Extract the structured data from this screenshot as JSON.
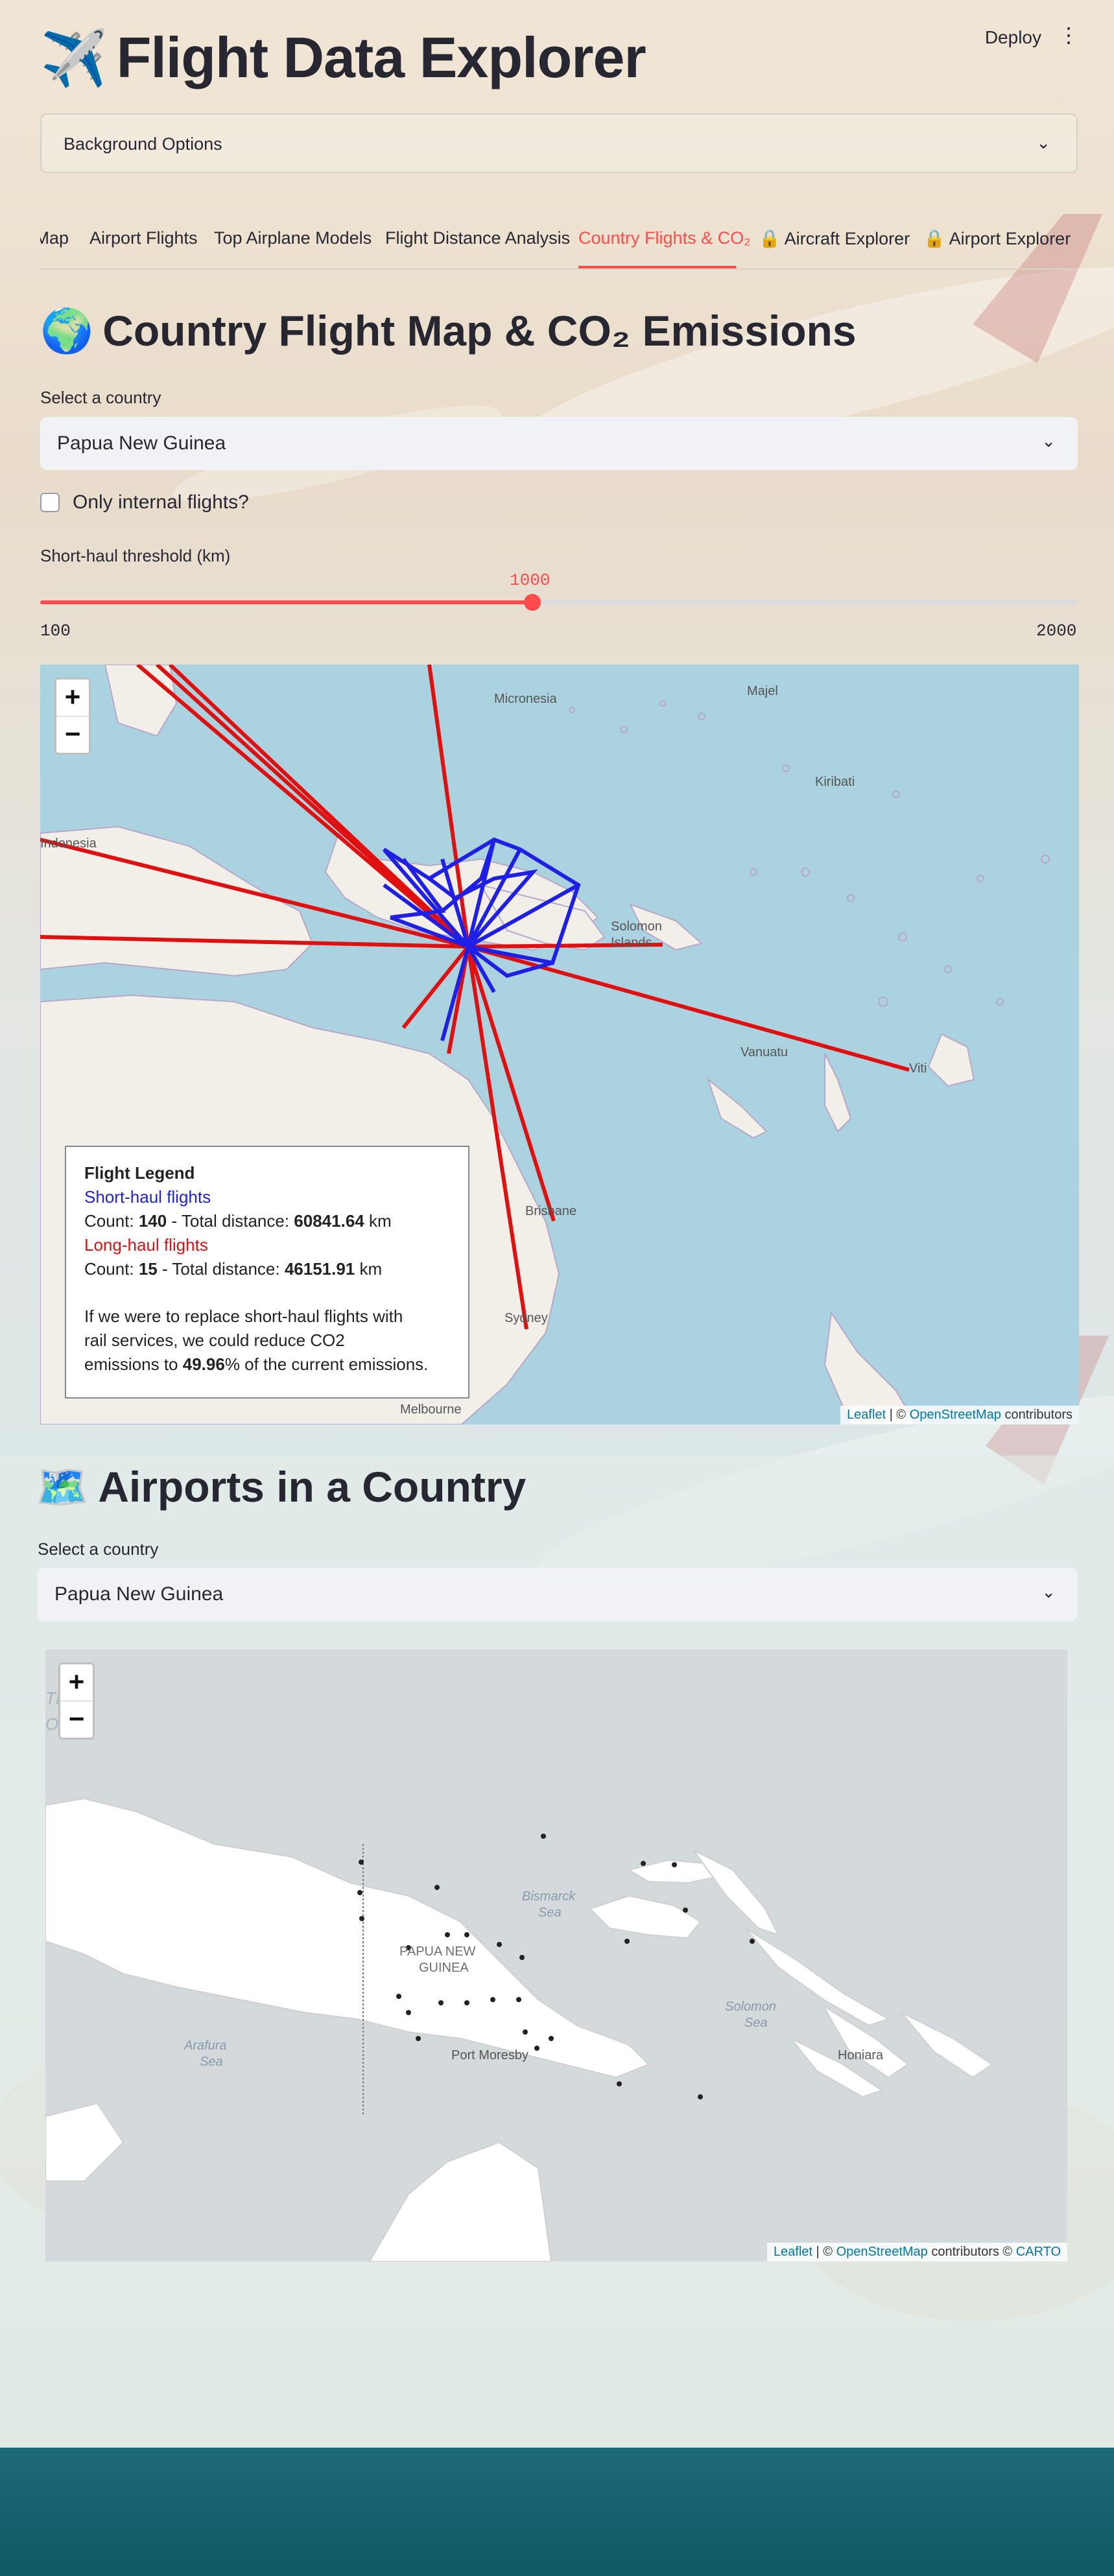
{
  "header": {
    "deploy_label": "Deploy",
    "menu_icon": "⋮"
  },
  "app": {
    "title_emoji": "✈️",
    "title": "Flight Data Explorer"
  },
  "expander": {
    "label": "Background Options",
    "chevron": "⌄"
  },
  "tabs": [
    {
      "label": "Map"
    },
    {
      "label": "Airport Flights"
    },
    {
      "label": "Top Airplane Models"
    },
    {
      "label": "Flight Distance Analysis"
    },
    {
      "label": "Country Flights & CO₂"
    },
    {
      "label": "🔒 Aircraft Explorer"
    },
    {
      "label": "🔒 Airport Explorer"
    }
  ],
  "section1": {
    "emoji": "🌍",
    "title": "Country Flight Map & CO₂ Emissions",
    "select_label": "Select a country",
    "select_value": "Papua New Guinea",
    "checkbox_label": "Only internal flights?",
    "checkbox_checked": false,
    "slider_label": "Short-haul threshold (km)",
    "slider_value": "1000",
    "slider_min": "100",
    "slider_max": "2000"
  },
  "map1": {
    "zoom_in": "+",
    "zoom_out": "−",
    "attribution_leaflet": "Leaflet",
    "attribution_sep": " | © ",
    "attribution_osm": "OpenStreetMap",
    "attribution_tail": " contributors",
    "labels": {
      "micronesia": "Micronesia",
      "majel": "Majel",
      "kiribati": "Kiribati",
      "indonesia": "Indonesia",
      "solomon": "Solomon",
      "islands": "Islands",
      "vanuatu": "Vanuatu",
      "viti": "Viti",
      "brisbane": "Brisbane",
      "sydney": "Sydney",
      "melbourne": "Melbourne"
    },
    "colors": {
      "short_haul": "#1f1fe6",
      "long_haul": "#e01010",
      "ocean": "#aad3df"
    },
    "legend": {
      "title": "Flight Legend",
      "short_label": "Short-haul flights",
      "short_count_prefix": "Count: ",
      "short_count": "140",
      "short_mid": " - Total distance: ",
      "short_distance": "60841.64",
      "short_unit": " km",
      "long_label": "Long-haul flights",
      "long_count_prefix": "Count: ",
      "long_count": "15",
      "long_mid": " - Total distance: ",
      "long_distance": "46151.91",
      "long_unit": " km",
      "note_1": "If we were to replace short-haul flights with",
      "note_2": "rail services, we could reduce CO2",
      "note_3_prefix": "emissions to ",
      "note_3_value": "49.96",
      "note_3_suffix": "% of the current emissions."
    }
  },
  "section2": {
    "emoji": "🗺️",
    "title": "Airports in a Country",
    "select_label": "Select a country",
    "select_value": "Papua New Guinea"
  },
  "map2": {
    "zoom_in": "+",
    "zoom_out": "−",
    "attribution_leaflet": "Leaflet",
    "attribution_sep": " | © ",
    "attribution_osm": "OpenStreetMap",
    "attribution_mid": " contributors © ",
    "attribution_carto": "CARTO",
    "labels": {
      "bismarck": "Bismarck",
      "sea1": "Sea",
      "png1": "PAPUA NEW",
      "png2": "GUINEA",
      "arafura": "Arafura",
      "sea2": "Sea",
      "port_moresby": "Port Moresby",
      "solomon": "Solomon",
      "sea3": "Sea",
      "honiara": "Honiara",
      "edge1": "TL",
      "edge2": "OC"
    }
  }
}
